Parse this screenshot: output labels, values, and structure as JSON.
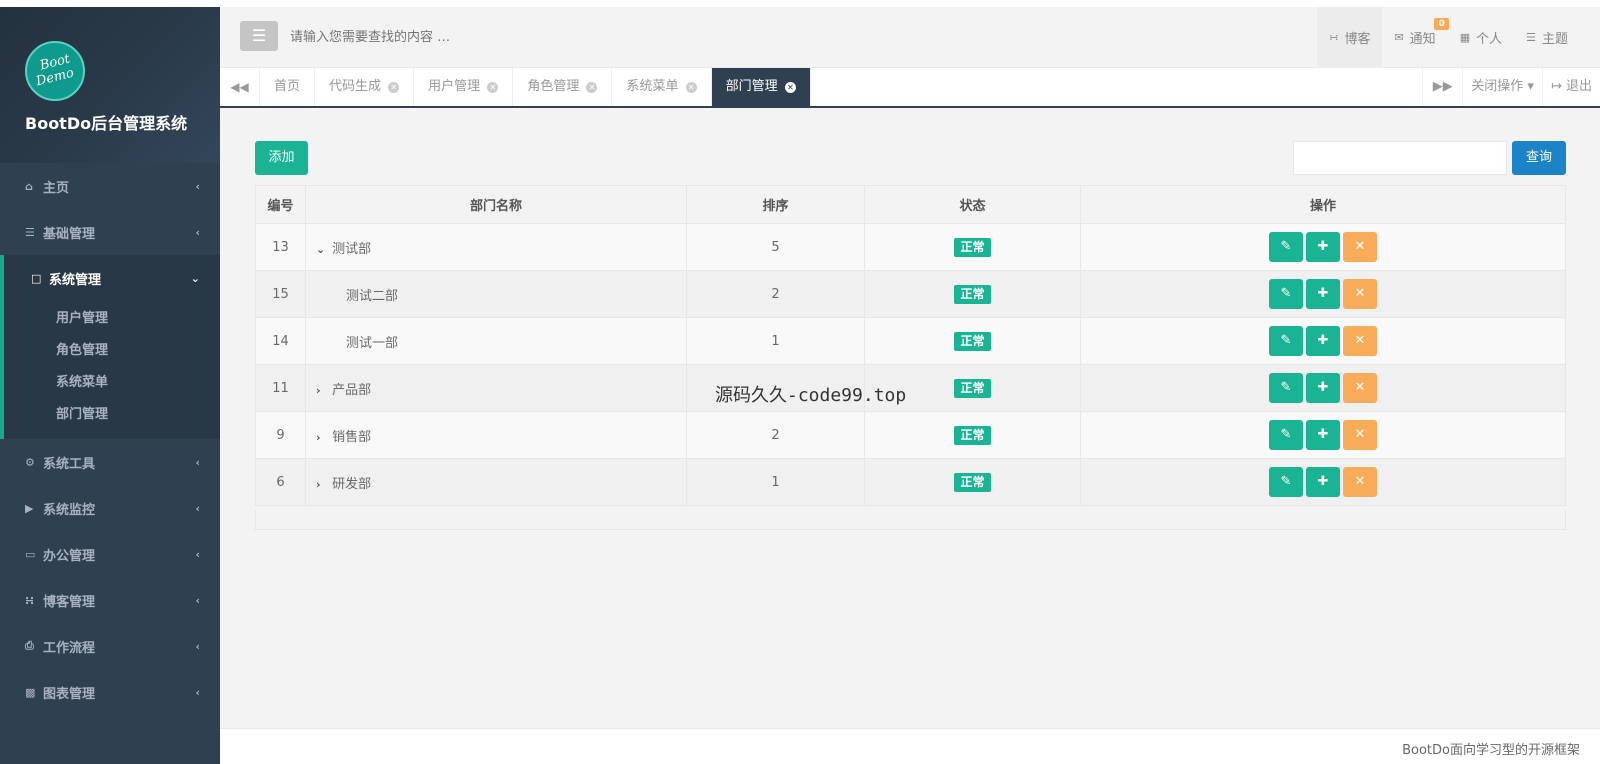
{
  "sidebar": {
    "logo_line1": "Boot",
    "logo_line2": "Demo",
    "system_name": "BootDo后台管理系统",
    "items": [
      {
        "label": "主页",
        "icon": "home-icon"
      },
      {
        "label": "基础管理",
        "icon": "list-icon"
      },
      {
        "label": "系统管理",
        "icon": "desktop-icon",
        "active": true
      },
      {
        "label": "系统工具",
        "icon": "gear-icon"
      },
      {
        "label": "系统监控",
        "icon": "video-icon"
      },
      {
        "label": "办公管理",
        "icon": "laptop-icon"
      },
      {
        "label": "博客管理",
        "icon": "rss-icon"
      },
      {
        "label": "工作流程",
        "icon": "print-icon"
      },
      {
        "label": "图表管理",
        "icon": "bar-chart-icon"
      }
    ],
    "submenu": [
      "用户管理",
      "角色管理",
      "系统菜单",
      "部门管理"
    ]
  },
  "topbar": {
    "search_placeholder": "请输入您需要查找的内容 …",
    "links": {
      "blog": "博客",
      "notify": "通知",
      "notify_count": "0",
      "personal": "个人",
      "theme": "主题"
    }
  },
  "tabs": {
    "items": [
      "首页",
      "代码生成",
      "用户管理",
      "角色管理",
      "系统菜单",
      "部门管理"
    ],
    "close_ops": "关闭操作",
    "logout": "退出"
  },
  "content": {
    "add_label": "添加",
    "query_label": "查询",
    "columns": [
      "编号",
      "部门名称",
      "排序",
      "状态",
      "操作"
    ],
    "rows": [
      {
        "id": "13",
        "name": "测试部",
        "order": "5",
        "status": "正常"
      },
      {
        "id": "15",
        "name": "测试二部",
        "order": "2",
        "status": "正常"
      },
      {
        "id": "14",
        "name": "测试一部",
        "order": "1",
        "status": "正常"
      },
      {
        "id": "11",
        "name": "产品部",
        "order": "",
        "status": "正常"
      },
      {
        "id": "9",
        "name": "销售部",
        "order": "2",
        "status": "正常"
      },
      {
        "id": "6",
        "name": "研发部",
        "order": "1",
        "status": "正常"
      }
    ]
  },
  "watermark": "源码久久-code99.top",
  "footer": "BootDo面向学习型的开源框架",
  "colors": {
    "sidebar": "#2f4050",
    "primary": "#1ab394",
    "info": "#1c84c6",
    "warning": "#f8ac59"
  }
}
